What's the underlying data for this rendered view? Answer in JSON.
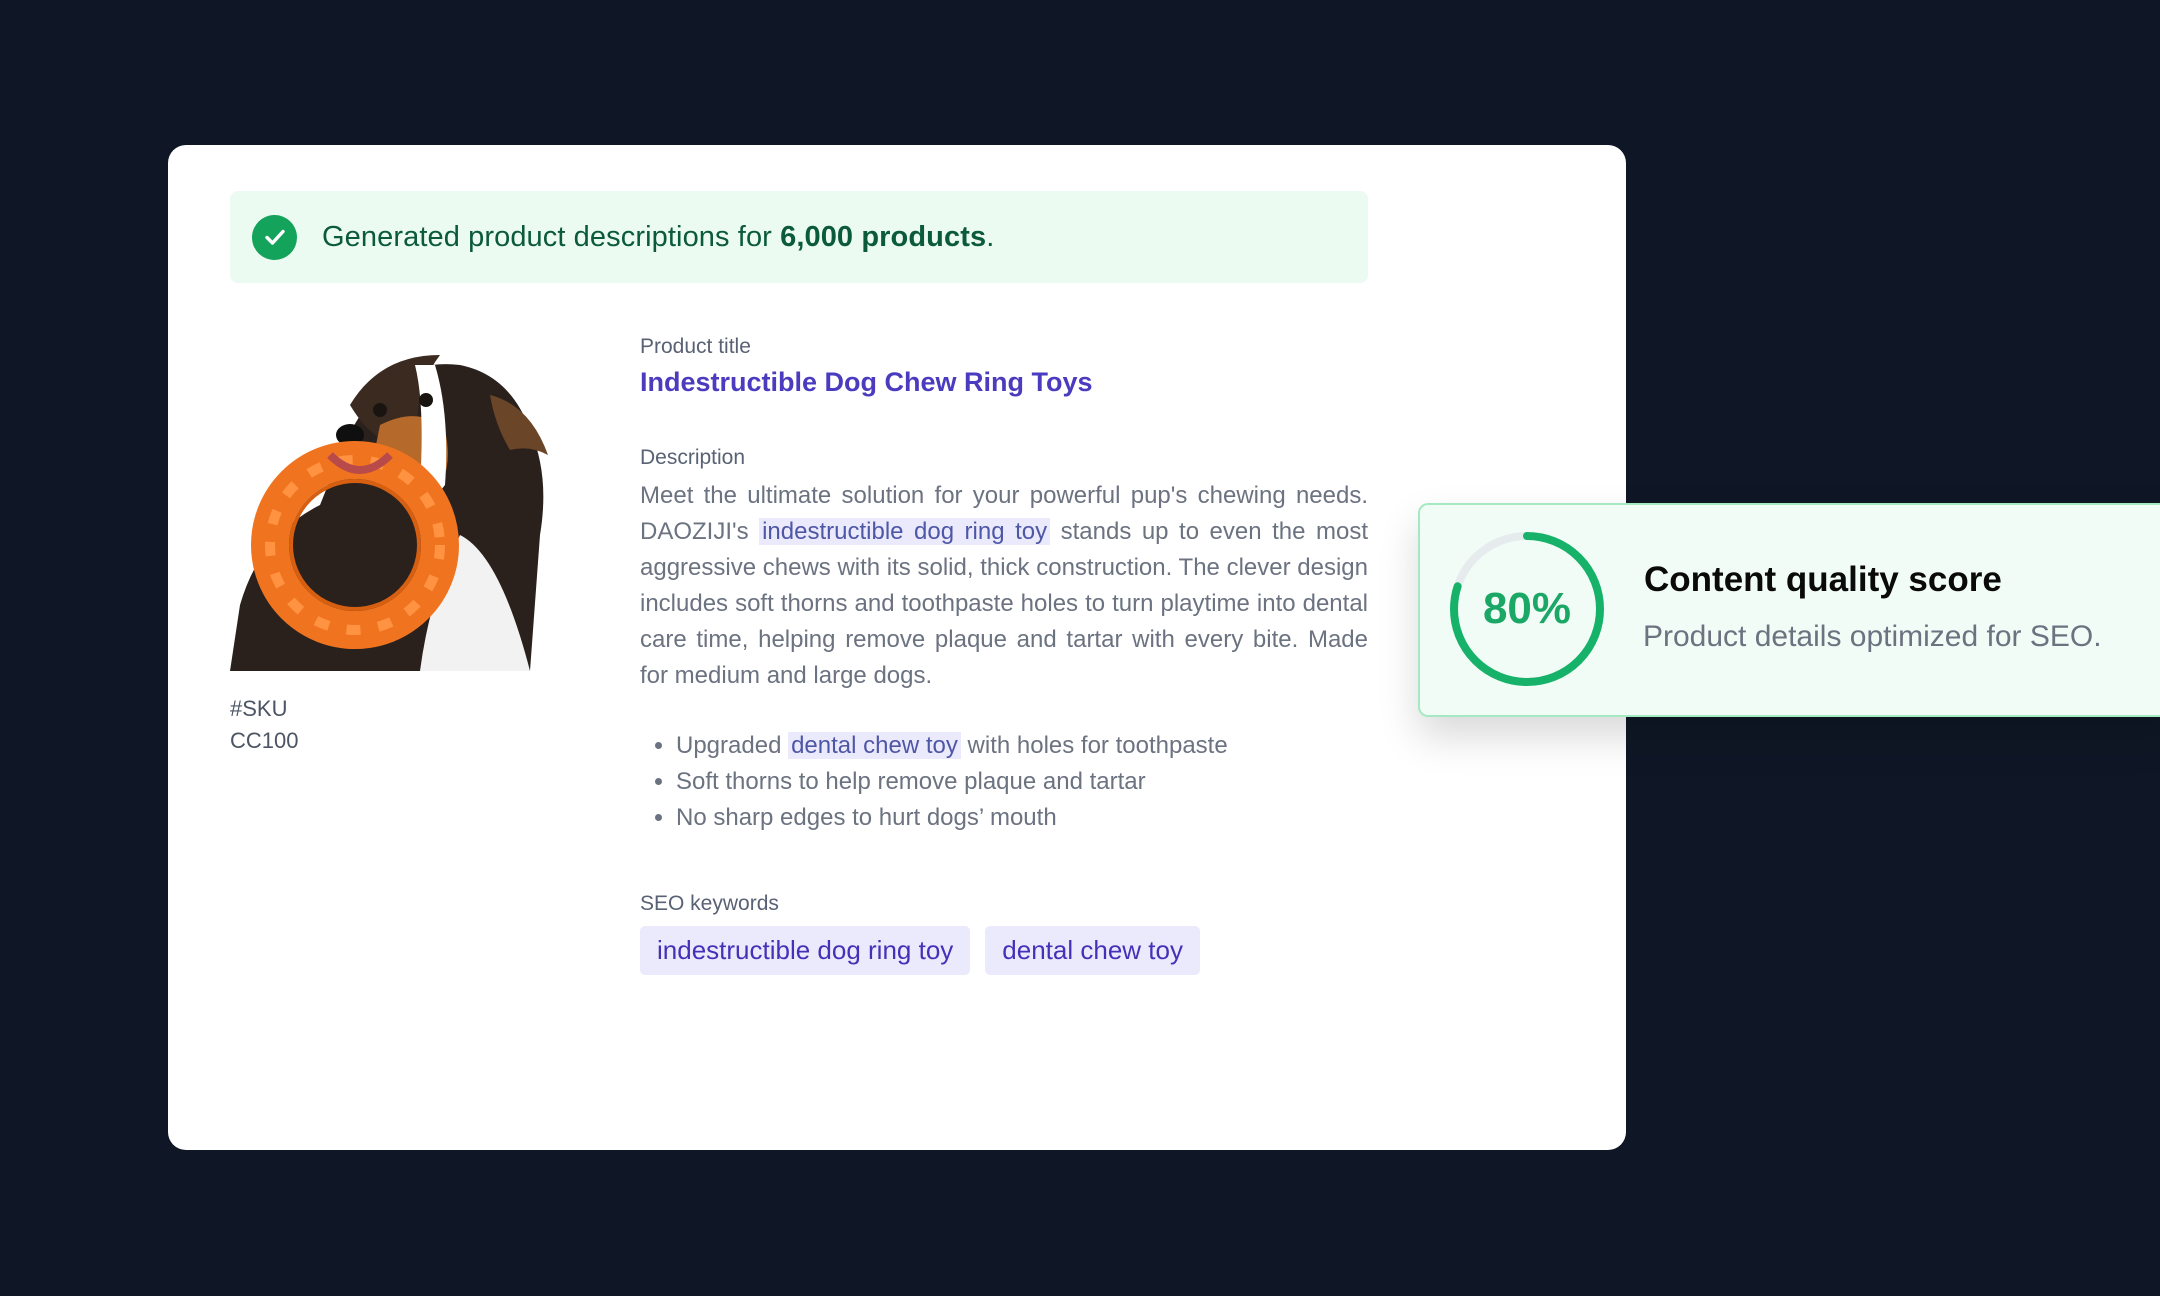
{
  "banner": {
    "prefix": "Generated product descriptions for ",
    "count": "6,000 products",
    "suffix": "."
  },
  "product": {
    "sku_label": "#SKU",
    "sku_value": "CC100",
    "title_label": "Product title",
    "title": "Indestructible Dog Chew Ring Toys",
    "description_label": "Description",
    "description": {
      "part1": "Meet the ultimate solution for your powerful pup's chewing needs. DAOZIJI's ",
      "keyword": "indestructible dog ring toy",
      "part2": " stands up to even the most aggressive chews with its solid, thick construction. The clever design includes soft thorns and toothpaste holes to turn playtime into dental care time, helping remove plaque and tartar with every bite. Made for medium and large dogs."
    },
    "bullets": [
      {
        "prefix": "Upgraded ",
        "keyword": "dental chew toy",
        "suffix": " with holes for toothpaste"
      },
      {
        "text": "Soft thorns to help remove plaque and tartar"
      },
      {
        "text": "No sharp edges to hurt dogs’ mouth"
      }
    ],
    "seo_label": "SEO keywords",
    "seo_keywords": [
      "indestructible dog ring toy",
      "dental chew toy"
    ]
  },
  "score": {
    "value_text": "80%",
    "value_fraction": 0.8,
    "title": "Content quality score",
    "subtitle": "Product details optimized for SEO."
  },
  "colors": {
    "background": "#0f1726",
    "accent_green": "#13a35b",
    "accent_purple": "#4a3bbf",
    "highlight": "#ebeafc"
  },
  "icons": {
    "banner_icon": "check-circle-icon"
  }
}
